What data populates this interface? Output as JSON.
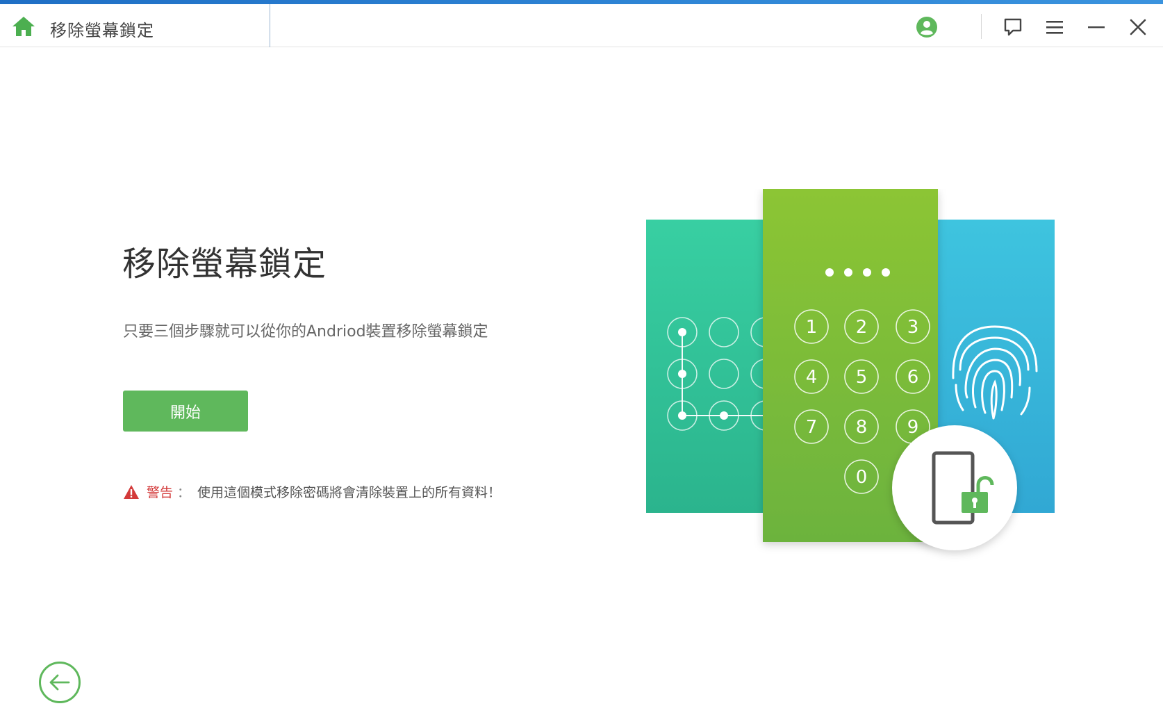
{
  "app": {
    "title": "移除螢幕鎖定"
  },
  "toolbar": {
    "account_icon": "user-circle-icon",
    "feedback_icon": "chat-bubble-icon",
    "menu_icon": "hamburger-menu-icon",
    "minimize_icon": "minimize-icon",
    "close_icon": "close-icon"
  },
  "main": {
    "heading": "移除螢幕鎖定",
    "subtext": "只要三個步驟就可以從你的Andriod裝置移除螢幕鎖定",
    "start_label": "開始",
    "warning_label": "警告",
    "warning_colon": "：",
    "warning_text": "使用這個模式移除密碼將會清除裝置上的所有資料！"
  },
  "illustration": {
    "keypad_digits": [
      "1",
      "2",
      "3",
      "4",
      "5",
      "6",
      "7",
      "8",
      "9",
      "0"
    ]
  },
  "colors": {
    "accent_green": "#5fb85c",
    "warning_red": "#d33a3a",
    "card_teal": "#33c79c",
    "card_lime": "#86c232",
    "card_blue": "#34b4d8"
  }
}
